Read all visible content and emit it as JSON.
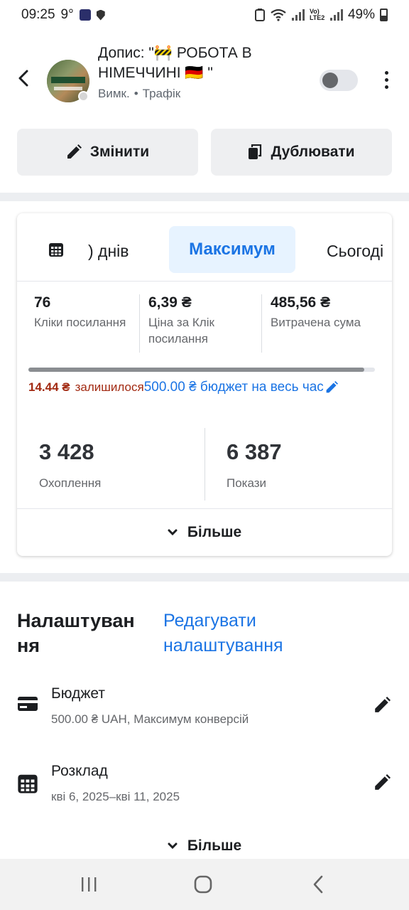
{
  "status_bar": {
    "time": "09:25",
    "temperature": "9°",
    "battery": "49%",
    "network_label": "Vo) LTE2"
  },
  "header": {
    "title": "Допис: \"🚧 РОБОТА В НІМЕЧЧИНІ 🇩🇪 \"",
    "status": "Вимк.",
    "separator": "•",
    "objective": "Трафік",
    "toggle_on": false
  },
  "actions": {
    "edit_label": "Змінити",
    "duplicate_label": "Дублювати"
  },
  "stats": {
    "tabs": {
      "days_label": ") днів",
      "max_label": "Максимум",
      "today_label": "Сьогоді"
    },
    "metrics": [
      {
        "value": "76",
        "label": "Кліки посилання"
      },
      {
        "value": "6,39 ₴",
        "label": "Ціна за Клік посилання"
      },
      {
        "value": "485,56 ₴",
        "label": "Витрачена сума"
      }
    ],
    "budget_spent_fraction": 0.97,
    "remaining_value": "14.44 ₴",
    "remaining_label": "залишилося",
    "total_budget": "500.00 ₴ бюджет на весь час",
    "reach": {
      "value": "3 428",
      "label": "Охоплення"
    },
    "impressions": {
      "value": "6 387",
      "label": "Покази"
    },
    "more_label": "Більше"
  },
  "settings": {
    "title": "Налаштування",
    "title_display": "Налаштуван ня",
    "edit_link": "Редагувати налаштування",
    "budget": {
      "title": "Бюджет",
      "subtitle": "500.00 ₴ UAH, Максимум конверсій"
    },
    "schedule": {
      "title": "Розклад",
      "subtitle": "кві 6, 2025–кві 11, 2025"
    },
    "more_label": "Більше"
  },
  "colors": {
    "accent": "#1b74e4",
    "warning": "#a22a12",
    "tab_highlight": "#e7f3ff"
  }
}
